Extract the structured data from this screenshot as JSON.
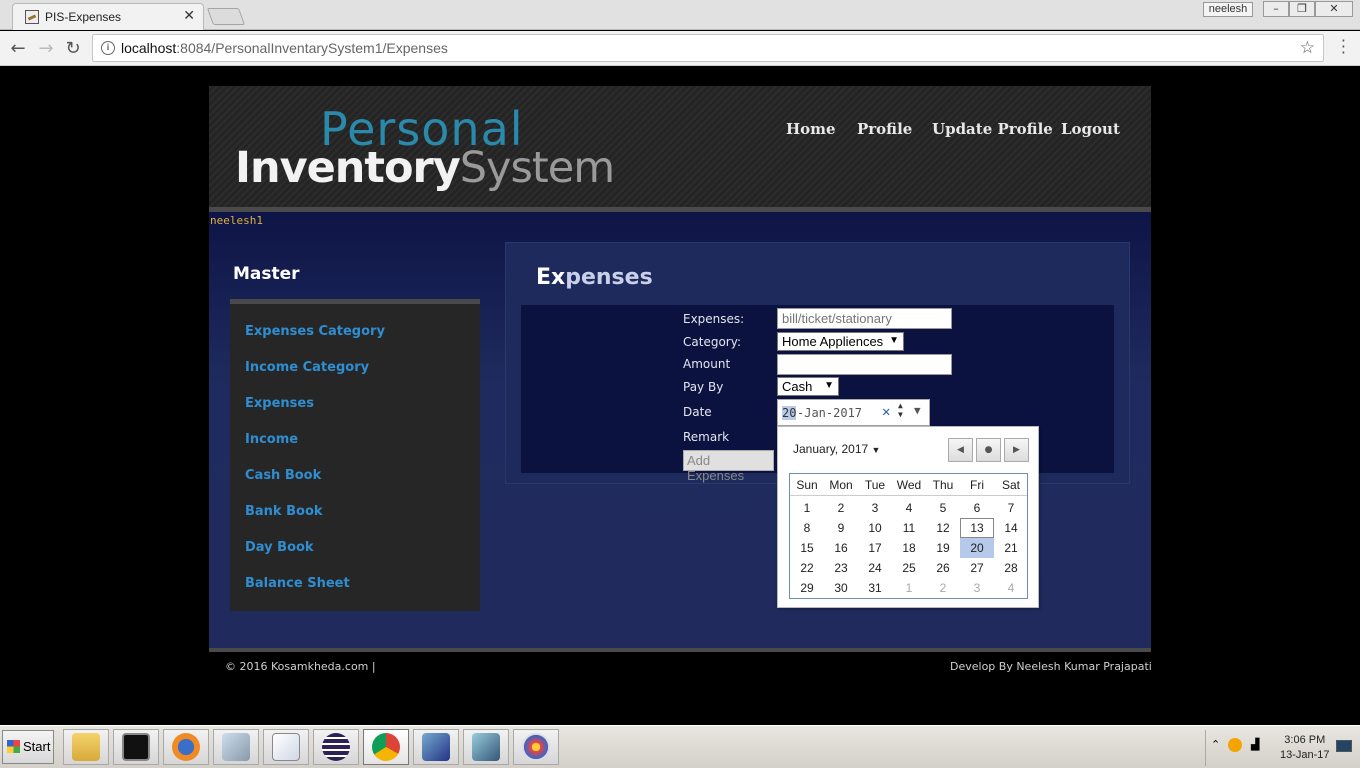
{
  "browser": {
    "tab_title": "PIS-Expenses",
    "tab_close": "✕",
    "user_badge": "neelesh",
    "url_host": "localhost",
    "url_rest": ":8084/PersonalInventarySystem1/Expenses"
  },
  "site": {
    "logo_top": "Personal",
    "logo_bottom_a": "Inventory",
    "logo_bottom_b": "System",
    "nav": [
      "Home",
      "Profile",
      "Update Profile",
      "Logout"
    ],
    "username": "neelesh1",
    "master_title": "Master",
    "sidebar": [
      "Expenses Category",
      "Income Category",
      "Expenses",
      "Income",
      "Cash Book",
      "Bank Book",
      "Day Book",
      "Balance Sheet"
    ],
    "page_title_first": "Ex",
    "page_title_rest": "penses"
  },
  "form": {
    "expenses_label": "Expenses:",
    "expenses_placeholder": "bill/ticket/stationary",
    "category_label": "Category:",
    "category_value": "Home Appliences",
    "amount_label": "Amount",
    "amount_value": "",
    "payby_label": "Pay By",
    "payby_value": "Cash",
    "date_label": "Date",
    "date_day": "20",
    "date_rest": "-Jan-2017",
    "remark_label": "Remark",
    "submit_label": "Add Expenses"
  },
  "calendar": {
    "month_label": "January, 2017",
    "weekdays": [
      "Sun",
      "Mon",
      "Tue",
      "Wed",
      "Thu",
      "Fri",
      "Sat"
    ],
    "weeks": [
      [
        "1",
        "2",
        "3",
        "4",
        "5",
        "6",
        "7"
      ],
      [
        "8",
        "9",
        "10",
        "11",
        "12",
        "13",
        "14"
      ],
      [
        "15",
        "16",
        "17",
        "18",
        "19",
        "20",
        "21"
      ],
      [
        "22",
        "23",
        "24",
        "25",
        "26",
        "27",
        "28"
      ],
      [
        "29",
        "30",
        "31",
        "1",
        "2",
        "3",
        "4"
      ]
    ],
    "today": "13",
    "selected": "20"
  },
  "footer": {
    "left": "© 2016 Kosamkheda.com |",
    "right": "Develop By Neelesh Kumar Prajapati"
  },
  "taskbar": {
    "start_label": "Start",
    "time": "3:06 PM",
    "date": "13-Jan-17"
  },
  "colors": {
    "accent_link": "#2f8ed1",
    "logo_blue": "#2a8aac",
    "page_blue": "#202a5c"
  }
}
